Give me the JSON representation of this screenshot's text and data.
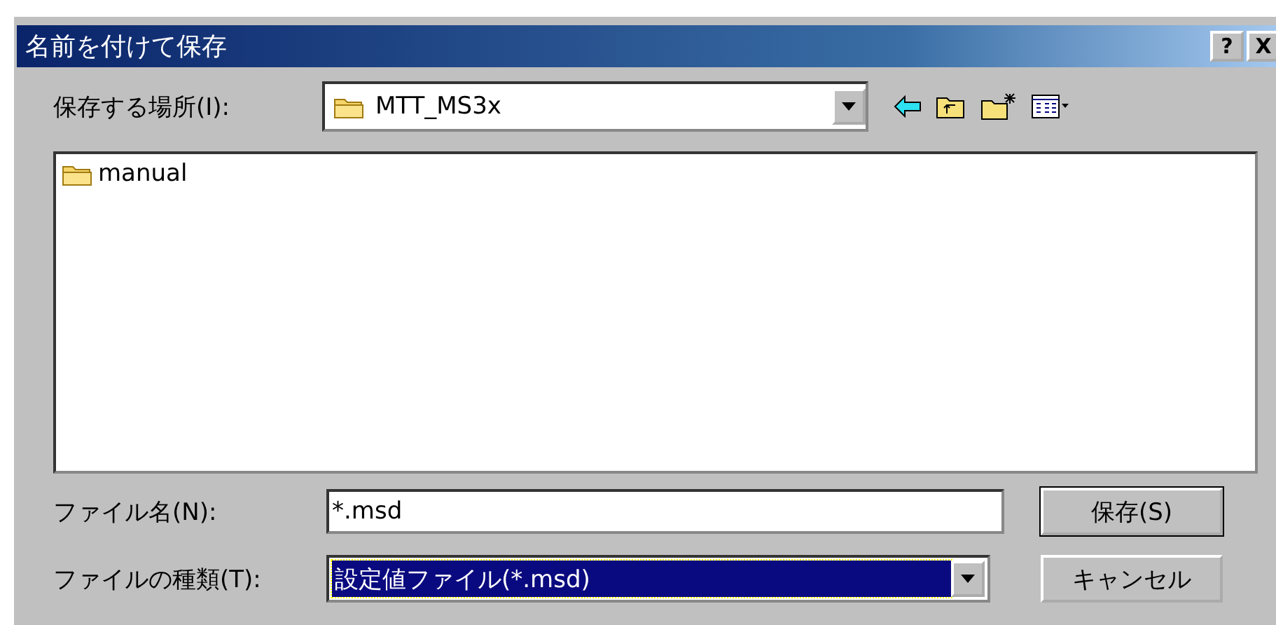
{
  "window": {
    "title": "名前を付けて保存",
    "help_button": "?",
    "close_button": "X"
  },
  "save_in": {
    "label": "保存する場所(I):",
    "value": "MTT_MS3x"
  },
  "files": [
    {
      "name": "manual",
      "kind": "folder"
    }
  ],
  "file_name": {
    "label": "ファイル名(N):",
    "value": "*.msd"
  },
  "file_type": {
    "label": "ファイルの種類(T):",
    "value": "設定値ファイル(*.msd)",
    "selected": true
  },
  "buttons": [
    "保存(S)",
    "キャンセル"
  ]
}
